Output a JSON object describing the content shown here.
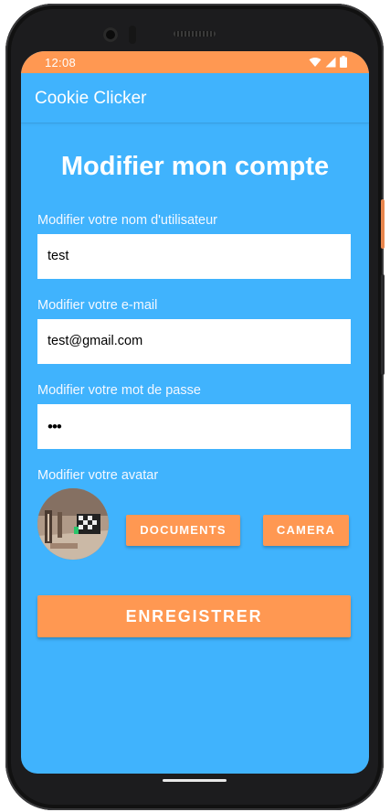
{
  "status_bar": {
    "time": "12:08"
  },
  "app_bar": {
    "title": "Cookie Clicker"
  },
  "page": {
    "title": "Modifier mon compte"
  },
  "form": {
    "username_label": "Modifier votre nom d'utilisateur",
    "username_value": "test",
    "email_label": "Modifier votre e-mail",
    "email_value": "test@gmail.com",
    "password_label": "Modifier votre mot de passe",
    "password_value": "•••",
    "avatar_label": "Modifier votre avatar"
  },
  "buttons": {
    "documents": "DOCUMENTS",
    "camera": "CAMERA",
    "save": "ENREGISTRER"
  },
  "colors": {
    "primary": "#40b3fd",
    "accent": "#ff9852",
    "text_on_primary": "#ffffff"
  },
  "icons": [
    "wifi-icon",
    "signal-icon",
    "battery-icon"
  ]
}
